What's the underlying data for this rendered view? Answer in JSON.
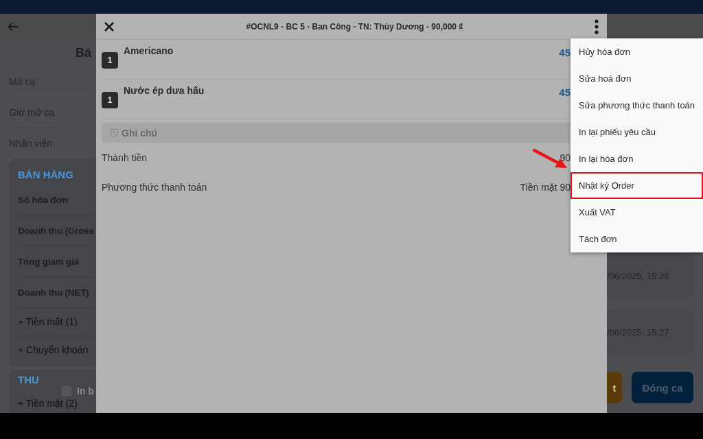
{
  "screen": {
    "title": "Bá",
    "fields": [
      {
        "label": "Mã ca"
      },
      {
        "label": "Giờ mở ca"
      },
      {
        "label": "Nhân viên"
      }
    ],
    "sales_card": {
      "heading": "BÁN HÀNG",
      "rows": [
        {
          "label": "Số hóa đơn",
          "kind": "bold"
        },
        {
          "label": "Doanh thu (Gross",
          "kind": "bold"
        },
        {
          "label": "Tổng giảm giá",
          "kind": "bold"
        },
        {
          "label": "Doanh thu (NET)",
          "kind": "bold"
        },
        {
          "label": "+ Tiền mặt (1)",
          "kind": "sub"
        },
        {
          "label": "+ Chuyển khoản",
          "kind": "sub"
        }
      ]
    },
    "income_card": {
      "heading": "THU",
      "rows": [
        {
          "label": "+ Tiền mặt (2)",
          "kind": "sub"
        }
      ]
    },
    "print_option": {
      "label": "In b",
      "checked": false
    },
    "history": [
      {
        "time": "/06/2025, 15:28"
      },
      {
        "time": "/06/2025, 15:27"
      }
    ],
    "actions": [
      {
        "label": "t",
        "kind": "secondary"
      },
      {
        "label": "Đóng ca",
        "kind": "primary"
      }
    ]
  },
  "dialog": {
    "title": "#OCNL9 - BC 5 - Ban Công - TN: Thùy Dương - 90,000 ₫",
    "items": [
      {
        "quantity": "1",
        "name": "Americano",
        "price": "45"
      },
      {
        "quantity": "1",
        "name": "Nước ép dưa hấu",
        "price": "45"
      }
    ],
    "note": {
      "placeholder": "Ghi chú"
    },
    "summary": [
      {
        "label": "Thành tiền",
        "value": "90"
      },
      {
        "label": "Phương thức thanh toán",
        "value": "Tiền mặt 90"
      }
    ]
  },
  "menu": {
    "items": [
      {
        "label": "Hủy hóa đơn",
        "highlighted": false
      },
      {
        "label": "Sửa hoá đơn",
        "highlighted": false
      },
      {
        "label": "Sửa phương thức thanh toán",
        "highlighted": false
      },
      {
        "label": "In lại phiếu yêu cầu",
        "highlighted": false
      },
      {
        "label": "In lại hóa đơn",
        "highlighted": false
      },
      {
        "label": "Nhật ký Order",
        "highlighted": true
      },
      {
        "label": "Xuất VAT",
        "highlighted": false
      },
      {
        "label": "Tách đơn",
        "highlighted": false
      }
    ]
  }
}
